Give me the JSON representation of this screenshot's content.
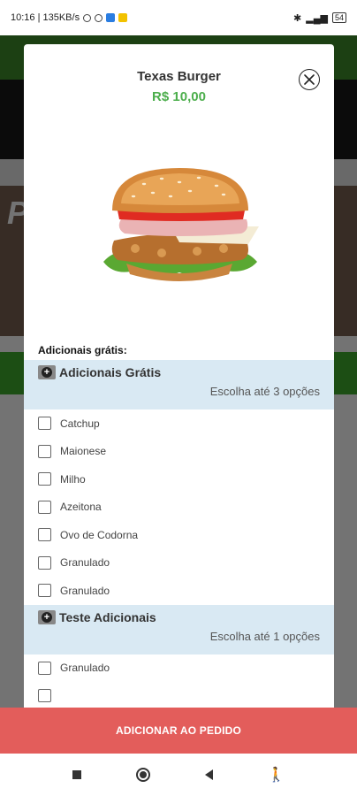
{
  "status_bar": {
    "left_text": "10:16 | 135KB/s",
    "battery": "54"
  },
  "background": {
    "hero_text": "P"
  },
  "product": {
    "name": "Texas Burger",
    "price": "R$ 10,00"
  },
  "section_label": "Adicionais grátis:",
  "groups": [
    {
      "title": "Adicionais Grátis",
      "subtitle": "Escolha até 3 opções",
      "options": [
        "Catchup",
        "Maionese",
        "Milho",
        "Azeitona",
        "Ovo de Codorna",
        "Granulado",
        "Granulado"
      ]
    },
    {
      "title": "Teste Adicionais",
      "subtitle": "Escolha até 1 opções",
      "options": [
        "Granulado"
      ]
    }
  ],
  "add_button_label": "ADICIONAR AO PEDIDO",
  "colors": {
    "price": "#4cae4c",
    "group_bg": "#d9e9f3",
    "add_button": "#e35d5b",
    "header_green": "#3e8f2a"
  },
  "icons": {
    "close": "close-circle-icon",
    "plus": "plus-circle-icon",
    "nav_recent": "square-icon",
    "nav_home": "home-circle-icon",
    "nav_back": "back-triangle-icon",
    "nav_accessibility": "accessibility-icon"
  }
}
